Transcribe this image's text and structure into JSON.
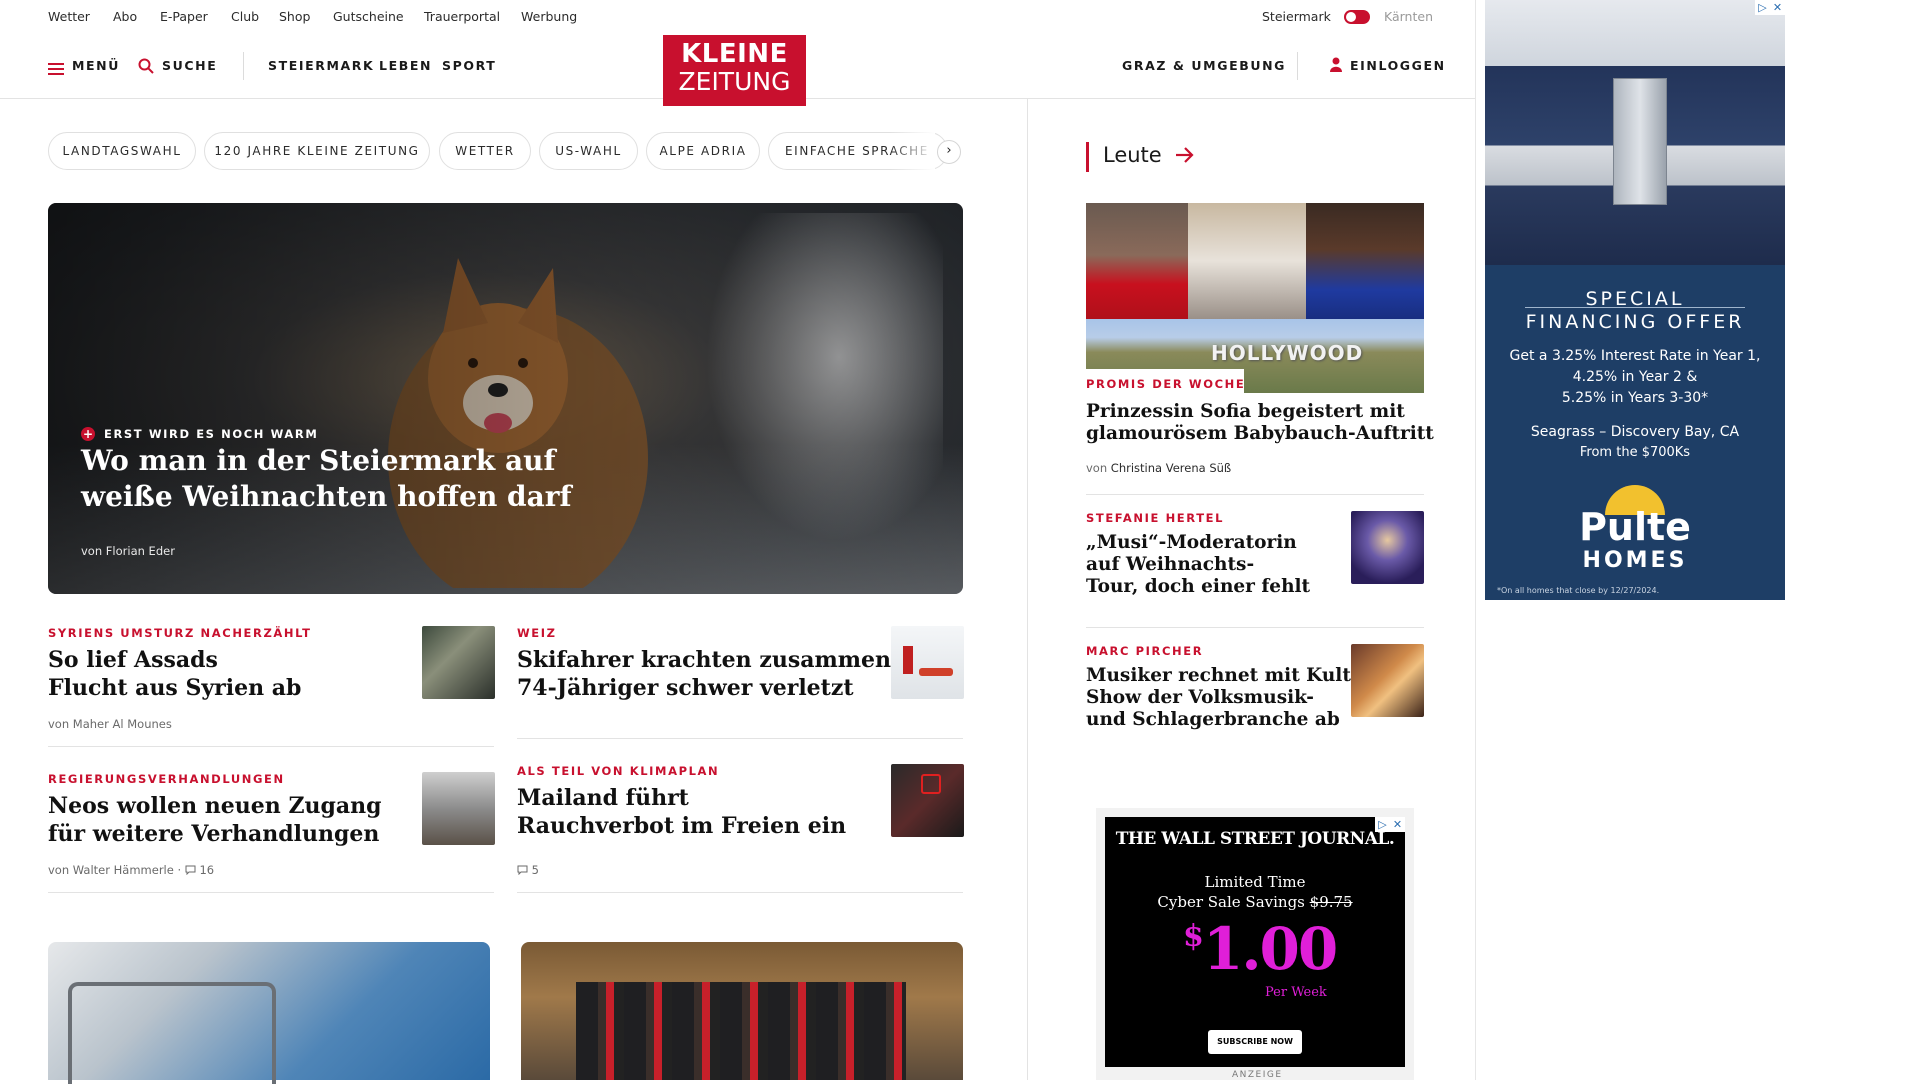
{
  "utility": {
    "links": [
      "Wetter",
      "Abo",
      "E-Paper",
      "Club",
      "Shop",
      "Gutscheine",
      "Trauerportal",
      "Werbung"
    ],
    "region_left": "Steiermark",
    "region_right": "Kärnten"
  },
  "nav": {
    "menu": "MENÜ",
    "search": "SUCHE",
    "sections": [
      "STEIERMARK",
      "LEBEN",
      "SPORT"
    ],
    "logo_line1": "KLEINE",
    "logo_line2": "ZEITUNG",
    "graz": "GRAZ & UMGEBUNG",
    "login": "EINLOGGEN"
  },
  "topics": [
    "LANDTAGSWAHL",
    "120 JAHRE KLEINE ZEITUNG",
    "WETTER",
    "US-WAHL",
    "ALPE ADRIA",
    "EINFACHE SPRACHE"
  ],
  "hero": {
    "kicker": "ERST WIRD ES NOCH WARM",
    "title_line1": "Wo man in der Steiermark auf",
    "title_line2": "weiße Weihnachten hoffen darf",
    "by_prefix": "von",
    "author": "Florian Eder"
  },
  "articles": [
    {
      "kicker": "SYRIENS UMSTURZ NACHERZÄHLT",
      "line1": "So lief Assads",
      "line2": "Flucht aus Syrien ab",
      "by_prefix": "von",
      "author": "Maher Al Mounes"
    },
    {
      "kicker": "WEIZ",
      "line1": "Skifahrer krachten zusammen:",
      "line2": "74-Jähriger schwer verletzt"
    },
    {
      "kicker": "REGIERUNGSVERHANDLUNGEN",
      "line1": "Neos wollen neuen Zugang",
      "line2": "für weitere Verhandlungen",
      "by_prefix": "von",
      "author": "Walter Hämmerle",
      "comments": "16"
    },
    {
      "kicker": "ALS TEIL VON KLIMAPLAN",
      "line1": "Mailand führt",
      "line2": "Rauchverbot im Freien ein",
      "comments": "5"
    }
  ],
  "sidebar": {
    "section_title": "Leute",
    "lead": {
      "kicker": "PROMIS DER WOCHE",
      "line1": "Prinzessin Sofia begeistert mit",
      "line2": "glamourösem Babybauch-Auftritt",
      "by_prefix": "von",
      "author": "Christina Verena Süß",
      "image_sign": "HOLLYWOOD"
    },
    "items": [
      {
        "kicker": "STEFANIE HERTEL",
        "line1": "„Musi“-Moderatorin",
        "line2": "auf Weihnachts-",
        "line3": "Tour, doch einer fehlt"
      },
      {
        "kicker": "MARC PIRCHER",
        "line1": "Musiker rechnet mit Kult-",
        "line2": "Show der Volksmusik-",
        "line3": "und Schlagerbranche ab"
      }
    ]
  },
  "ad_pulte": {
    "line1": "SPECIAL",
    "line2": "FINANCING OFFER",
    "line3": "Get a 3.25% Interest Rate in Year 1,",
    "line4": "4.25% in Year 2 &",
    "line5": "5.25% in Years 3-30*",
    "line6": "Seagrass – Discovery Bay, CA",
    "line7": "From the $700Ks",
    "brand1": "Pulte",
    "brand2": "HOMES",
    "fine": "*On all homes that close by 12/27/2024."
  },
  "ad_wsj": {
    "brand": "THE WALL STREET JOURNAL.",
    "line1": "Limited Time",
    "line2": "Cyber Sale Savings",
    "old_price": "$9.75",
    "price_dollar": "$",
    "price": "1.00",
    "per": "Per Week",
    "cta": "SUBSCRIBE NOW",
    "label": "ANZEIGE"
  },
  "colors": {
    "accent": "#c8102e",
    "ad_navy": "#1e3e66",
    "ad_magenta": "#e01fd8"
  }
}
